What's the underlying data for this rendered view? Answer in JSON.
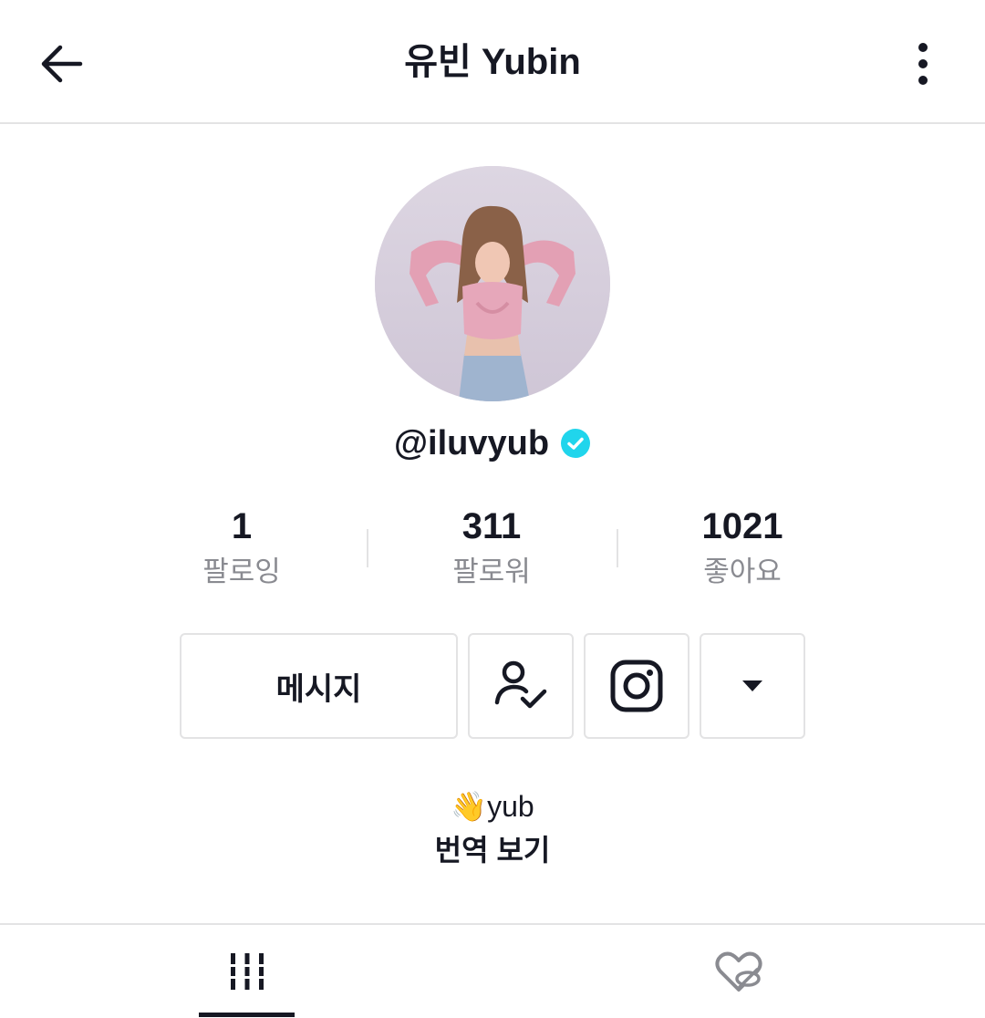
{
  "header": {
    "title": "유빈 Yubin",
    "back_icon": "arrow-left-icon",
    "more_icon": "vertical-ellipsis-icon"
  },
  "profile": {
    "handle": "@iluvyub",
    "verified_icon": "verified-badge-icon",
    "verified_color": "#20d5ec"
  },
  "stats": [
    {
      "value": "1",
      "label": "팔로잉"
    },
    {
      "value": "311",
      "label": "팔로워"
    },
    {
      "value": "1021",
      "label": "좋아요"
    }
  ],
  "actions": {
    "message_label": "메시지",
    "follow_icon": "person-check-icon",
    "instagram_icon": "instagram-icon",
    "dropdown_icon": "caret-down-icon"
  },
  "bio": {
    "emoji": "👋",
    "text": "yub",
    "translate_label": "번역 보기"
  },
  "tabs": [
    {
      "icon": "videos-grid-icon",
      "active": true
    },
    {
      "icon": "liked-hidden-icon",
      "active": false
    }
  ]
}
